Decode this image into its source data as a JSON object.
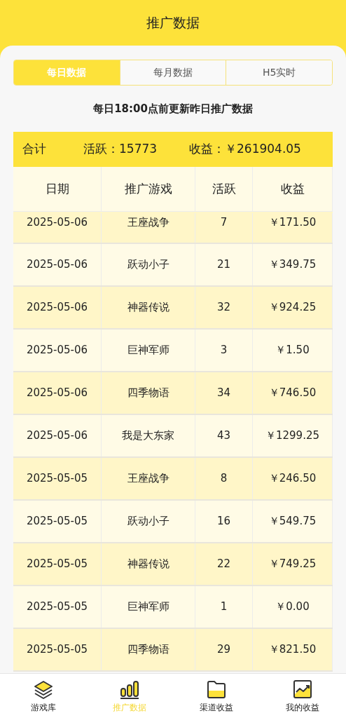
{
  "title": "推广数据",
  "tabs": [
    {
      "label": "每日数据",
      "selected": true
    },
    {
      "label": "每月数据",
      "selected": false
    },
    {
      "label": "H5实时",
      "selected": false
    }
  ],
  "notice": "每日18:00点前更新昨日推广数据",
  "summary": {
    "label": "合计",
    "active_label": "活跃：",
    "active": "15773",
    "income_label": "收益：",
    "income": "￥261904.05"
  },
  "table": {
    "columns": [
      "日期",
      "推广游戏",
      "活跃",
      "收益"
    ],
    "rows": [
      [
        "2025-05-06",
        "王座战争",
        "7",
        "￥171.50"
      ],
      [
        "2025-05-06",
        "跃动小子",
        "21",
        "￥349.75"
      ],
      [
        "2025-05-06",
        "神器传说",
        "32",
        "￥924.25"
      ],
      [
        "2025-05-06",
        "巨神军师",
        "3",
        "￥1.50"
      ],
      [
        "2025-05-06",
        "四季物语",
        "34",
        "￥746.50"
      ],
      [
        "2025-05-06",
        "我是大东家",
        "43",
        "￥1299.25"
      ],
      [
        "2025-05-05",
        "王座战争",
        "8",
        "￥246.50"
      ],
      [
        "2025-05-05",
        "跃动小子",
        "16",
        "￥549.75"
      ],
      [
        "2025-05-05",
        "神器传说",
        "22",
        "￥749.25"
      ],
      [
        "2025-05-05",
        "巨神军师",
        "1",
        "￥0.00"
      ],
      [
        "2025-05-05",
        "四季物语",
        "29",
        "￥821.50"
      ]
    ]
  },
  "nav": [
    {
      "label": "游戏库",
      "kind": "layers",
      "selected": false
    },
    {
      "label": "推广数据",
      "kind": "bars",
      "selected": true
    },
    {
      "label": "渠道收益",
      "kind": "folder",
      "selected": false
    },
    {
      "label": "我的收益",
      "kind": "chart",
      "selected": false
    }
  ]
}
